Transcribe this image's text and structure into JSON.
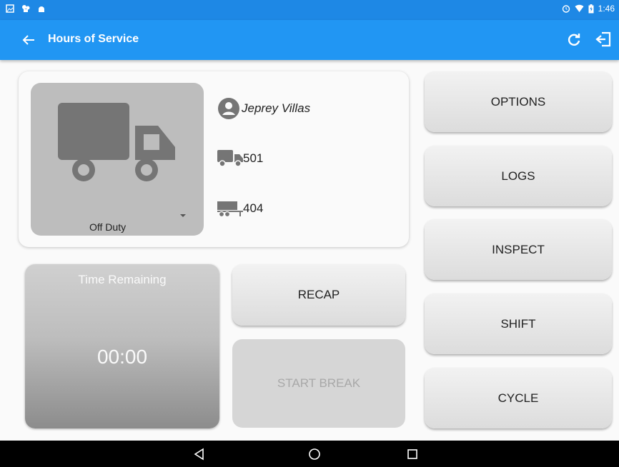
{
  "status_bar": {
    "time": "1:46",
    "icons": [
      "image-icon",
      "app-icon",
      "android-icon",
      "alarm-icon",
      "wifi-icon",
      "battery-icon"
    ]
  },
  "app_bar": {
    "title": "Hours of Service",
    "icons": [
      "back-arrow-icon",
      "refresh-icon",
      "logout-icon"
    ]
  },
  "driver_card": {
    "duty_status": "Off Duty",
    "driver_name": "Jeprey Villas",
    "vehicle": "501",
    "trailer": "404"
  },
  "time_remaining": {
    "label": "Time Remaining",
    "value": "00:00"
  },
  "actions": {
    "recap": "RECAP",
    "start_break": "START BREAK",
    "options": "OPTIONS",
    "logs": "LOGS",
    "inspect": "INSPECT",
    "shift": "SHIFT",
    "cycle": "CYCLE"
  },
  "colors": {
    "app_bar": "#2196f3",
    "status_bar": "#1e88e5",
    "truck_panel": "#bdbdbd",
    "truck_icon": "#757575"
  }
}
